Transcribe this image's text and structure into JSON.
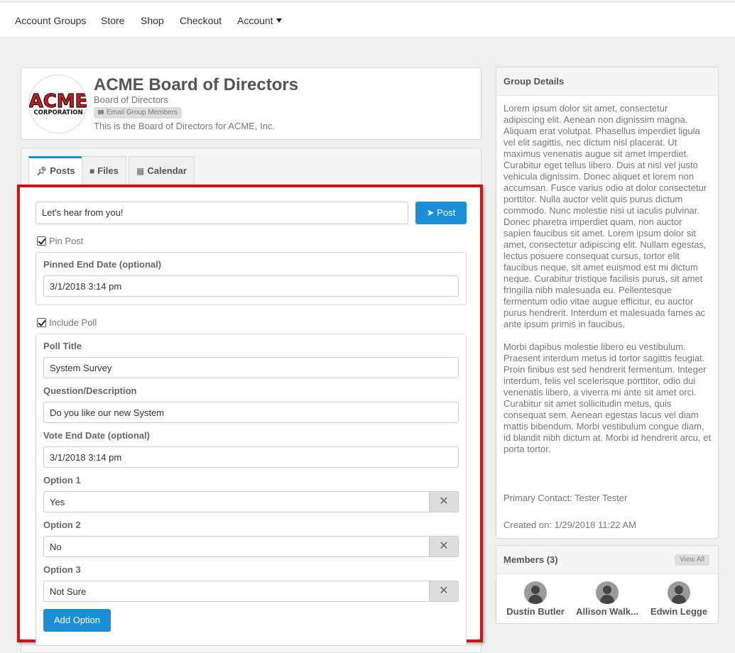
{
  "nav": {
    "items": [
      "Account Groups",
      "Store",
      "Shop",
      "Checkout",
      "Account"
    ]
  },
  "group": {
    "logo_text_top": "ACME",
    "logo_text_bottom": "CORPORATION",
    "title": "ACME Board of Directors",
    "subtitle": "Board of Directors",
    "email_badge": "Email Group Members",
    "description": "This is the Board of Directors for ACME, Inc."
  },
  "tabs": [
    {
      "label": "Posts",
      "icon": "pin-icon",
      "active": true
    },
    {
      "label": "Files",
      "icon": "folder-icon",
      "active": false
    },
    {
      "label": "Calendar",
      "icon": "calendar-icon",
      "active": false
    }
  ],
  "post_form": {
    "input_value": "Let's hear from you!",
    "post_label": "Post",
    "pin_post_label": "Pin Post",
    "pin_post_checked": true,
    "pinned_end_label": "Pinned End Date (optional)",
    "pinned_end_value": "3/1/2018 3:14 pm",
    "include_poll_label": "Include Poll",
    "include_poll_checked": true,
    "poll_title_label": "Poll Title",
    "poll_title_value": "System Survey",
    "question_label": "Question/Description",
    "question_value": "Do you like our new System",
    "vote_end_label": "Vote End Date (optional)",
    "vote_end_value": "3/1/2018 3:14 pm",
    "options": [
      {
        "label": "Option 1",
        "value": "Yes"
      },
      {
        "label": "Option 2",
        "value": "No"
      },
      {
        "label": "Option 3",
        "value": "Not Sure"
      }
    ],
    "add_option_label": "Add Option"
  },
  "details": {
    "heading": "Group Details",
    "para1": "Lorem ipsum dolor sit amet, consectetur adipiscing elit. Aenean non dignissim magna. Aliquam erat volutpat. Phasellus imperdiet ligula vel elit sagittis, nec dictum nisl placerat. Ut maximus venenatis augue sit amet imperdiet. Curabitur eget tellus libero. Duis at nisl vel justo vehicula dignissim. Donec aliquet et lorem non accumsan. Fusce varius odio at dolor consectetur porttitor. Nulla auctor velit quis purus dictum commodo. Nunc molestie nisi ut iaculis pulvinar. Donec pharetra imperdiet quam, non auctor sapien faucibus sit amet. Lorem ipsum dolor sit amet, consectetur adipiscing elit. Nullam egestas, lectus posuere consequat cursus, tortor elit faucibus neque, sit amet euismod est mi dictum neque. Curabitur tristique facilisis purus, sit amet fringilla nibh malesuada eu. Pellentesque fermentum odio vitae augue efficitur, eu auctor purus hendrerit. Interdum et malesuada fames ac ante ipsum primis in faucibus.",
    "para2": "Morbi dapibus molestie libero eu vestibulum. Praesent interdum metus id tortor sagittis feugiat. Proin finibus est sed hendrerit fermentum. Integer interdum, felis vel scelerisque porttitor, odio dui venenatis libero, a viverra mi ante sit amet orci. Curabitur sit amet sollicitudin metus, quis consequat sem. Aenean egestas lacus vel diam mattis bibendum. Morbi vestibulum congue diam, id blandit nibh dictum at. Morbi id hendrerit arcu, et porta tortor.",
    "primary_contact": "Primary Contact: Tester Tester",
    "created_on": "Created on: 1/29/2018 11:22 AM"
  },
  "members": {
    "heading": "Members (3)",
    "view_all": "View All",
    "list": [
      "Dustin Butler",
      "Allison Walk...",
      "Edwin Legge"
    ]
  },
  "colors": {
    "accent": "#1a8fd6",
    "highlight": "#cc1414"
  }
}
